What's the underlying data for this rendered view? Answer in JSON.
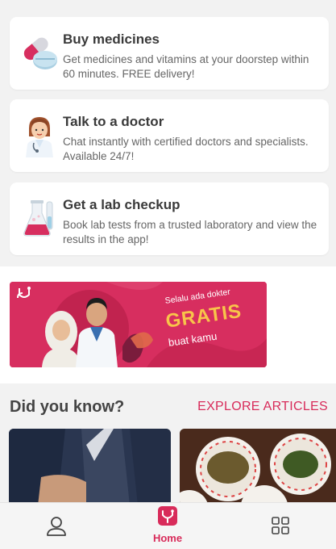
{
  "services": [
    {
      "title": "Buy medicines",
      "description": "Get medicines and vitamins at your doorstep within 60 minutes. FREE delivery!",
      "icon": "pills-icon"
    },
    {
      "title": "Talk to a doctor",
      "description": "Chat instantly with certified doctors and specialists. Available 24/7!",
      "icon": "doctor-icon"
    },
    {
      "title": "Get a lab checkup",
      "description": "Book lab tests from a trusted laboratory and view the results in the app!",
      "icon": "lab-flask-icon"
    }
  ],
  "banner": {
    "tagline": "Selalu ada dokter",
    "headline": "GRATIS",
    "subline": "buat kamu"
  },
  "did_you_know": {
    "title": "Did you know?",
    "explore_label": "EXPLORE ARTICLES"
  },
  "nav": {
    "home_label": "Home"
  },
  "colors": {
    "accent": "#d82b5a",
    "banner_bg": "#d72e5f",
    "banner_gold": "#f8c44a"
  }
}
